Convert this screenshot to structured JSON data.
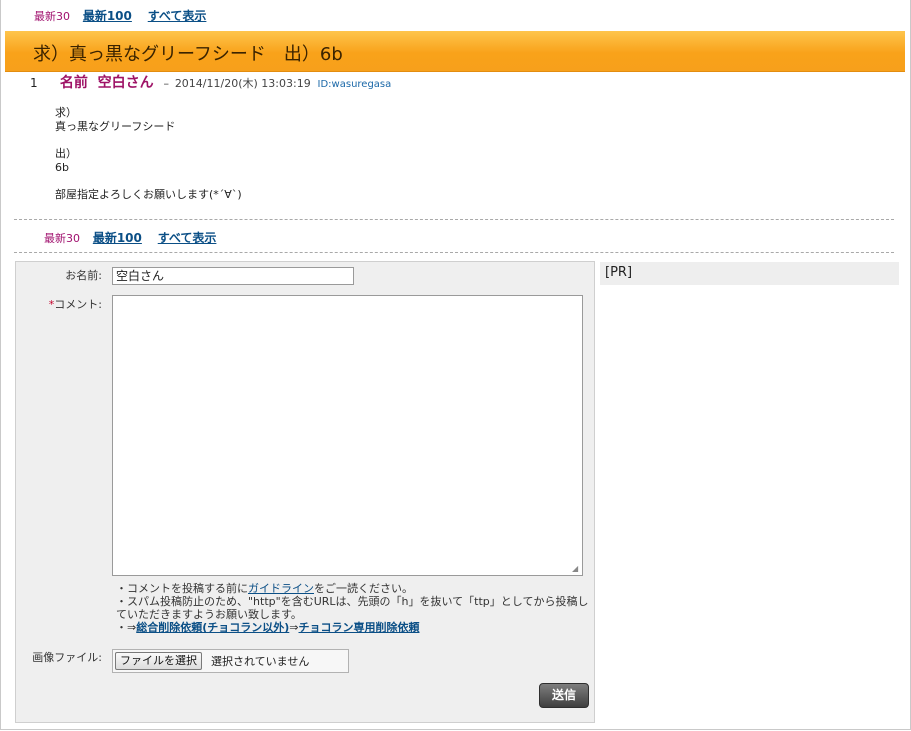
{
  "nav": {
    "current": "最新30",
    "latest100": "最新100",
    "show_all": "すべて表示"
  },
  "thread": {
    "title": "求）真っ黒なグリーフシード　出）6b"
  },
  "post": {
    "number": "1",
    "name_label": "名前",
    "name": "空白さん",
    "separator": "–",
    "date": "2014/11/20(木) 13:03:19",
    "id": "ID:wasuregasa",
    "body": [
      [
        "求）",
        "真っ黒なグリーフシード"
      ],
      [
        "出）",
        "6b"
      ],
      [
        "部屋指定よろしくお願いします(*´∀`)"
      ]
    ]
  },
  "form": {
    "name_label": "お名前:",
    "name_value": "空白さん",
    "comment_required_mark": "*",
    "comment_label": "コメント:",
    "note1_pre": "・コメントを投稿する前に",
    "note1_link": "ガイドライン",
    "note1_post": "をご一読ください。",
    "note2": "・スパム投稿防止のため、\"http\"を含むURLは、先頭の「h」を抜いて「ttp」としてから投稿していただきますようお願い致します。",
    "note3_pre": "・⇒",
    "note3_link1": "総合削除依頼(チョコラン以外)",
    "note3_mid": "⇒",
    "note3_link2": "チョコラン専用削除依頼",
    "image_label": "画像ファイル:",
    "file_button": "ファイルを選択",
    "file_status": "選択されていません",
    "submit": "送信"
  },
  "side": {
    "pr": "[PR]"
  },
  "colors": {
    "title_bar": "#f9a21a",
    "post_name": "#9e1266",
    "link": "#0b4f86"
  }
}
